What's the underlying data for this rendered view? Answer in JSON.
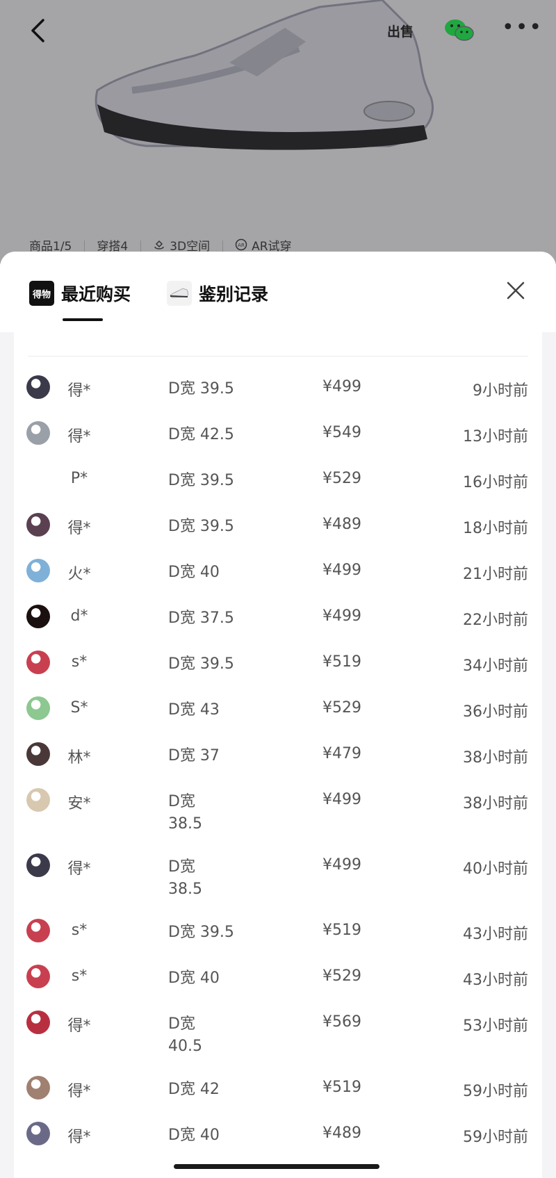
{
  "product": {
    "tabs": [
      {
        "label": "商品1/5",
        "icon": ""
      },
      {
        "label": "穿搭4",
        "icon": ""
      },
      {
        "label": "3D空间",
        "icon": "3d-icon"
      },
      {
        "label": "AR试穿",
        "icon": "ar-icon"
      }
    ],
    "sell_label": "出售"
  },
  "sheet": {
    "tabs": [
      {
        "label": "最近购买",
        "icon": "dewu-logo-icon",
        "logo_text": "得物",
        "active": true
      },
      {
        "label": "鉴别记录",
        "icon": "shoe-thumbnail-icon",
        "active": false
      }
    ]
  },
  "purchases": [
    {
      "user": "得*",
      "size": "D宽 39.5",
      "price": "¥499",
      "time": "9小时前",
      "avatar": "#3a3a4a"
    },
    {
      "user": "得*",
      "size": "D宽 42.5",
      "price": "¥549",
      "time": "13小时前",
      "avatar": "#9aa0a8"
    },
    {
      "user": "P*",
      "size": "D宽 39.5",
      "price": "¥529",
      "time": "16小时前",
      "avatar": ""
    },
    {
      "user": "得*",
      "size": "D宽 39.5",
      "price": "¥489",
      "time": "18小时前",
      "avatar": "#5a4050"
    },
    {
      "user": "火*",
      "size": "D宽 40",
      "price": "¥499",
      "time": "21小时前",
      "avatar": "#7fb0d8"
    },
    {
      "user": "d*",
      "size": "D宽 37.5",
      "price": "¥499",
      "time": "22小时前",
      "avatar": "#1a1010"
    },
    {
      "user": "s*",
      "size": "D宽 39.5",
      "price": "¥519",
      "time": "34小时前",
      "avatar": "#c84050"
    },
    {
      "user": "S*",
      "size": "D宽 43",
      "price": "¥529",
      "time": "36小时前",
      "avatar": "#8cc890"
    },
    {
      "user": "林*",
      "size": "D宽 37",
      "price": "¥479",
      "time": "38小时前",
      "avatar": "#4a3838"
    },
    {
      "user": "安*",
      "size": "D宽 38.5",
      "price": "¥499",
      "time": "38小时前",
      "avatar": "#d8c8b0"
    },
    {
      "user": "得*",
      "size": "D宽 38.5",
      "price": "¥499",
      "time": "40小时前",
      "avatar": "#3a3a4a"
    },
    {
      "user": "s*",
      "size": "D宽 39.5",
      "price": "¥519",
      "time": "43小时前",
      "avatar": "#c84050"
    },
    {
      "user": "s*",
      "size": "D宽 40",
      "price": "¥529",
      "time": "43小时前",
      "avatar": "#c84050"
    },
    {
      "user": "得*",
      "size": "D宽 40.5",
      "price": "¥569",
      "time": "53小时前",
      "avatar": "#b83040"
    },
    {
      "user": "得*",
      "size": "D宽 42",
      "price": "¥519",
      "time": "59小时前",
      "avatar": "#a08070"
    },
    {
      "user": "得*",
      "size": "D宽 40",
      "price": "¥489",
      "time": "59小时前",
      "avatar": "#6a6a88"
    }
  ]
}
